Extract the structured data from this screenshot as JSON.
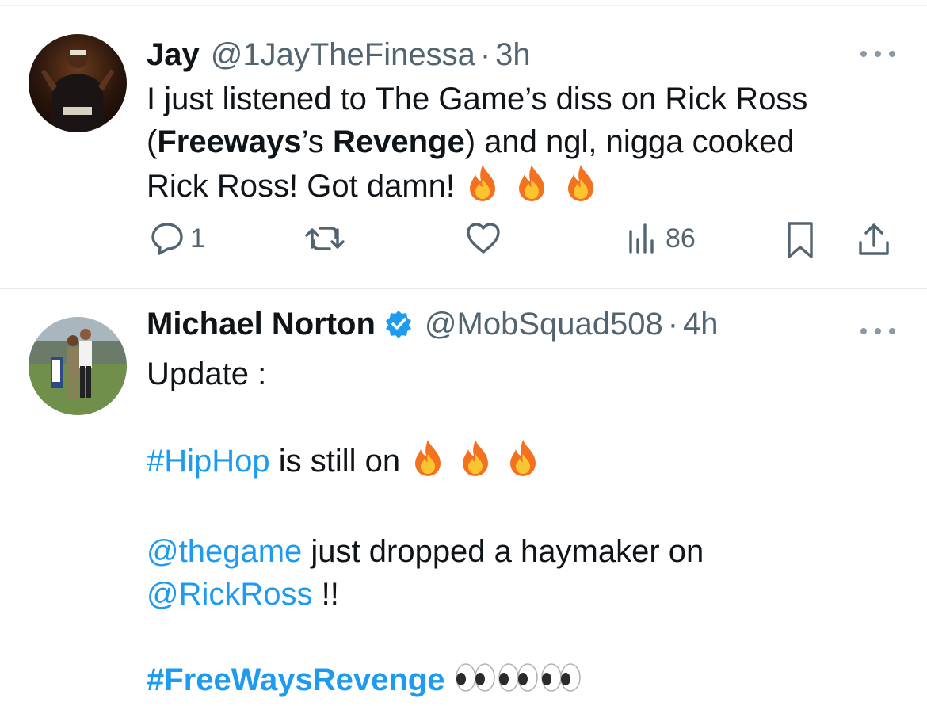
{
  "tweets": [
    {
      "name": "Jay",
      "handle": "@1JayTheFinessa",
      "separator": "·",
      "time": "3h",
      "text": {
        "line1": "I just listened to The Game’s diss on Rick Ross",
        "open_paren": "(",
        "bold1": "Freeways",
        "apostrophe": "’s ",
        "bold2": "Revenge",
        "after": ") and ngl, nigga cooked",
        "line3": "Rick Ross! Got damn! "
      },
      "emojis": [
        "fire",
        "fire",
        "fire"
      ],
      "actions": {
        "replies": "1",
        "retweets": "",
        "likes": "",
        "views": "86"
      }
    },
    {
      "name": "Michael Norton",
      "verified": true,
      "handle": "@MobSquad508",
      "separator": "·",
      "time": "4h",
      "text": {
        "p1": "Update :",
        "hashtag1": "#HipHop",
        "p2_rest": " is still on ",
        "mention1": "@thegame",
        "p3_rest": " just dropped a haymaker on",
        "mention2": "@RickRoss",
        "p4_rest": " !!",
        "hashtag2": "#FreeWaysRevenge"
      },
      "emojis_hiphop": [
        "fire",
        "fire",
        "fire"
      ],
      "emojis_freeways": [
        "eyes",
        "eyes",
        "eyes"
      ]
    }
  ],
  "colors": {
    "text": "#0f1419",
    "secondary": "#536471",
    "link": "#1d9bf0",
    "verified": "#1d9bf0"
  }
}
